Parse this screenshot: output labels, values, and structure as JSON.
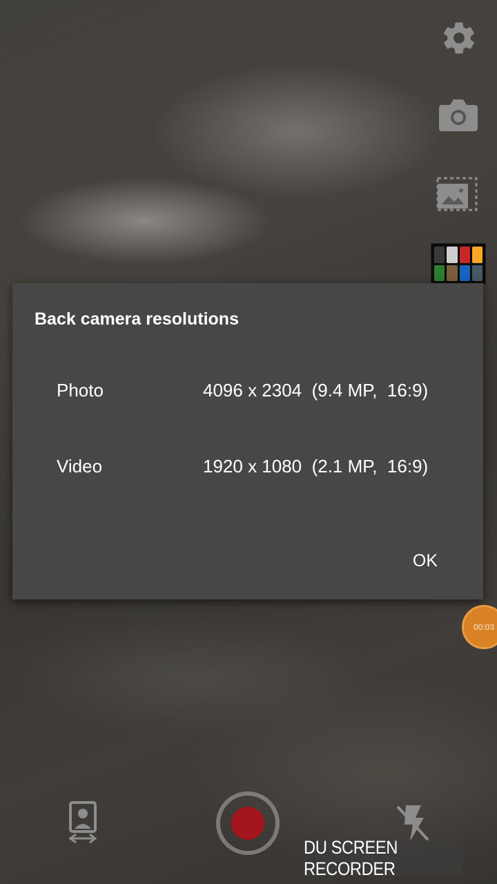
{
  "dialog": {
    "title": "Back camera resolutions",
    "rows": [
      {
        "label": "Photo",
        "value": "4096 x 2304  (9.4 MP,  16:9)"
      },
      {
        "label": "Video",
        "value": "1920 x 1080  (2.1 MP,  16:9)"
      }
    ],
    "ok_label": "OK"
  },
  "recorder": {
    "timer": "00:03",
    "watermark": "DU SCREEN RECORDER",
    "timer_color": "#d98225"
  },
  "icons": {
    "settings": "gear-icon",
    "camera_mode": "camera-icon",
    "aspect_ratio": "aspect-ratio-icon",
    "switch_camera": "switch-camera-icon",
    "flash": "flash-off-icon"
  },
  "colors": {
    "dialog_bg": "#474747",
    "record_dot": "#a3161b"
  }
}
